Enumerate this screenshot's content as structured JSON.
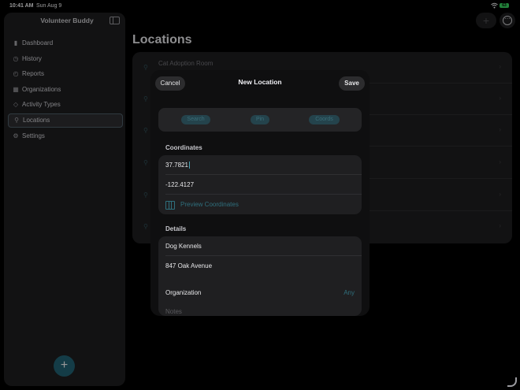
{
  "status": {
    "time": "10:41 AM",
    "date": "Sun Aug 9",
    "battery": "63"
  },
  "sidebar": {
    "title": "Volunteer Buddy",
    "items": [
      {
        "label": "Dashboard",
        "icon": "chart-bar-icon"
      },
      {
        "label": "History",
        "icon": "clock-arrow-icon"
      },
      {
        "label": "Reports",
        "icon": "clock-icon"
      },
      {
        "label": "Organizations",
        "icon": "building-icon"
      },
      {
        "label": "Activity Types",
        "icon": "tag-icon"
      },
      {
        "label": "Locations",
        "icon": "location-pin-icon",
        "active": true
      },
      {
        "label": "Settings",
        "icon": "gear-icon"
      }
    ],
    "add_label": "+"
  },
  "main": {
    "title": "Locations",
    "rows": [
      {
        "name": "Cat Adoption Room"
      },
      {
        "name": ""
      },
      {
        "name": ""
      },
      {
        "name": ""
      },
      {
        "name": ""
      },
      {
        "name": ""
      }
    ]
  },
  "sheet": {
    "cancel_label": "Cancel",
    "title": "New Location",
    "save_label": "Save",
    "segments": [
      "Search",
      "Pin",
      "Coords"
    ],
    "coordinates_header": "Coordinates",
    "latitude": "37.7821",
    "longitude": "-122.4127",
    "preview_label": "Preview Coordinates",
    "details_header": "Details",
    "name_value": "Dog Kennels",
    "address_value": "847 Oak Avenue",
    "organization_label": "Organization",
    "organization_value": "Any",
    "notes_placeholder": "Notes"
  },
  "colors": {
    "accent": "#2f6f7d",
    "fab": "#1f5d6d",
    "battery": "#35c759"
  }
}
